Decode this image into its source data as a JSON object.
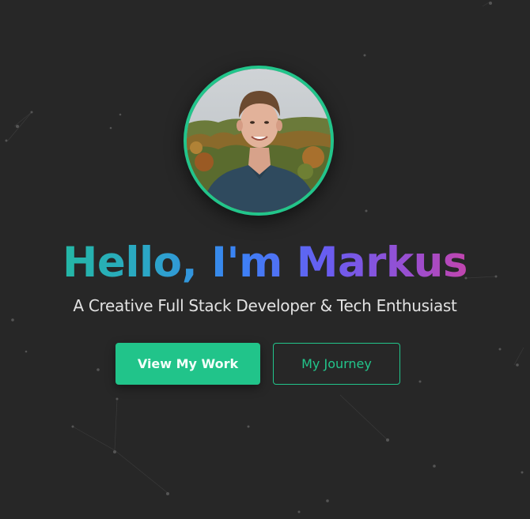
{
  "hero": {
    "greeting": "Hello, I'm Markus",
    "tagline": "A Creative Full Stack Developer & Tech Enthusiast",
    "primary_button": "View My Work",
    "secondary_button": "My Journey",
    "avatar_alt": "Portrait photo of Markus"
  },
  "colors": {
    "background": "#272727",
    "accent": "#22c58b",
    "gradient": [
      "#1fc48d",
      "#3b82f6",
      "#a24cc9",
      "#ef3c86"
    ],
    "text_secondary": "#e2e2e2"
  },
  "background_decoration": "particles-network"
}
